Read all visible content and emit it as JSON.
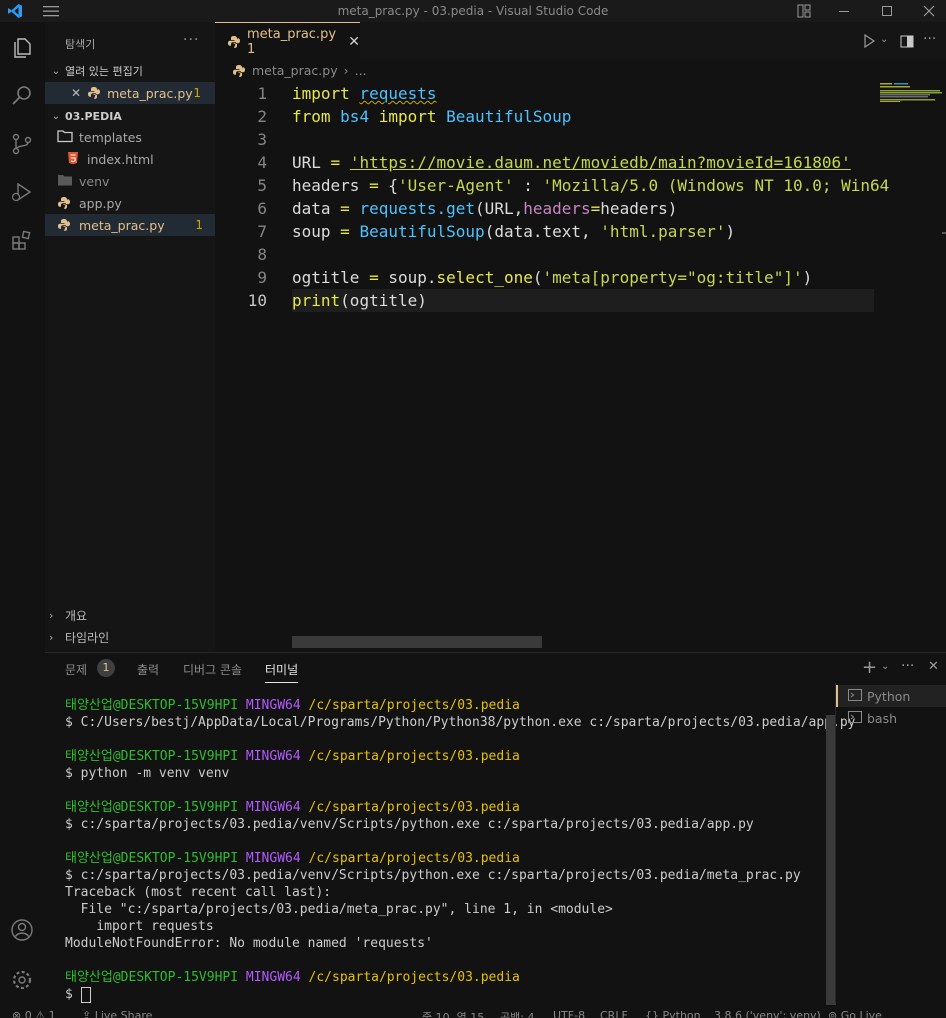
{
  "window": {
    "title": "meta_prac.py - 03.pedia - Visual Studio Code"
  },
  "colors": {
    "accent": "#e2c08d",
    "keyword": "#e8e845",
    "string": "#c5d94a",
    "function": "#4cc2ff",
    "terminal_green": "#2ebd2e",
    "terminal_magenta": "#b35bff",
    "terminal_yellow": "#e5c100"
  },
  "sidebar": {
    "title": "탐색기",
    "open_editors": {
      "label": "열려 있는 편집기",
      "items": [
        {
          "name": "meta_prac.py",
          "badge": "1"
        }
      ]
    },
    "folder": {
      "label": "03.PEDIA",
      "items": [
        {
          "name": "templates",
          "icon": "folder-icon"
        },
        {
          "name": "index.html",
          "icon": "html-icon"
        },
        {
          "name": "venv",
          "icon": "folder-icon"
        },
        {
          "name": "app.py",
          "icon": ""
        },
        {
          "name": "meta_prac.py",
          "icon": "python-icon",
          "badge": "1"
        }
      ]
    },
    "outline": "개요",
    "timeline": "타임라인"
  },
  "editor": {
    "tab": {
      "label": "meta_prac.py 1"
    },
    "breadcrumb": {
      "file": "meta_prac.py",
      "more": "..."
    },
    "line_numbers": [
      "1",
      "2",
      "3",
      "4",
      "5",
      "6",
      "7",
      "8",
      "9",
      "10"
    ],
    "code": {
      "l1_kw": "import",
      "l1_mod": "requests",
      "l2_kw": "from",
      "l2_mod": "bs4",
      "l2_kw2": "import",
      "l2_cls": "BeautifulSoup",
      "l4_var": "URL",
      "l4_op": "=",
      "l4_str": "'https://movie.daum.net/moviedb/main?movieId=161806'",
      "l5_var": "headers",
      "l5_op": "=",
      "l5_punc": "{",
      "l5_str1": "'User-Agent'",
      "l5_colon": ":",
      "l5_str2": "'Mozilla/5.0 (Windows NT 10.0; Win64",
      "l6_var": "data",
      "l6_op": "=",
      "l6_fn": "requests.get",
      "l6_args1": "(URL,",
      "l6_param": "headers",
      "l6_op2": "=",
      "l6_args2": "headers)",
      "l7_var": "soup",
      "l7_op": "=",
      "l7_fn": "BeautifulSoup",
      "l7_args": "(data.text,",
      "l7_str": "'html.parser'",
      "l7_close": ")",
      "l9_var": "ogtitle",
      "l9_op": "=",
      "l9_obj": "soup.",
      "l9_fn": "select_one",
      "l9_open": "(",
      "l9_str": "'meta[property=\"og:title\"]'",
      "l9_close": ")",
      "l10_fn": "print",
      "l10_args": "(ogtitle)"
    }
  },
  "panel": {
    "tabs": [
      {
        "label": "문제",
        "badge": "1"
      },
      {
        "label": "출력"
      },
      {
        "label": "디버그 콘솔"
      },
      {
        "label": "터미널",
        "active": true
      }
    ],
    "terminal": {
      "user": "태양산업@DESKTOP-15V9HPI",
      "shell": "MINGW64",
      "path": "/c/sparta/projects/03.pedia",
      "commands": [
        "$ C:/Users/bestj/AppData/Local/Programs/Python/Python38/python.exe c:/sparta/projects/03.pedia/app.py",
        "$ python -m venv venv",
        "$ c:/sparta/projects/03.pedia/venv/Scripts/python.exe c:/sparta/projects/03.pedia/app.py",
        "$ c:/sparta/projects/03.pedia/venv/Scripts/python.exe c:/sparta/projects/03.pedia/meta_prac.py"
      ],
      "traceback": [
        "Traceback (most recent call last):",
        "  File \"c:/sparta/projects/03.pedia/meta_prac.py\", line 1, in <module>",
        "    import requests",
        "ModuleNotFoundError: No module named 'requests'"
      ],
      "prompt": "$ "
    },
    "terminal_list": [
      {
        "label": "Python",
        "active": true
      },
      {
        "label": "bash"
      }
    ]
  },
  "statusbar": {
    "errors": "0",
    "warnings": "1",
    "live_share": "Live Share",
    "position": "줄 10, 열 15",
    "spaces": "공백: 4",
    "encoding": "UTF-8",
    "eol": "CRLF",
    "language": "Python",
    "interpreter": "3.8.6 ('venv': venv)",
    "go_live": "Go Live"
  }
}
